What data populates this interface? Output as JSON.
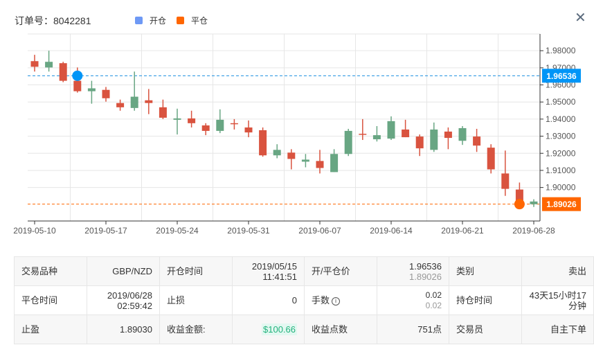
{
  "header": {
    "order_label": "订单号：8042281",
    "close_icon": "close-icon"
  },
  "legend": [
    {
      "label": "开仓",
      "color": "#6e99f5"
    },
    {
      "label": "平仓",
      "color": "#ff6600"
    }
  ],
  "chart_data": {
    "type": "candlestick",
    "x": [
      "2019-05-10",
      "2019-05-13",
      "2019-05-14",
      "2019-05-15",
      "2019-05-16",
      "2019-05-17",
      "2019-05-20",
      "2019-05-21",
      "2019-05-22",
      "2019-05-23",
      "2019-05-24",
      "2019-05-27",
      "2019-05-28",
      "2019-05-29",
      "2019-05-30",
      "2019-05-31",
      "2019-06-03",
      "2019-06-04",
      "2019-06-05",
      "2019-06-06",
      "2019-06-07",
      "2019-06-10",
      "2019-06-11",
      "2019-06-12",
      "2019-06-13",
      "2019-06-14",
      "2019-06-17",
      "2019-06-18",
      "2019-06-19",
      "2019-06-20",
      "2019-06-21",
      "2019-06-24",
      "2019-06-25",
      "2019-06-26",
      "2019-06-27",
      "2019-06-28"
    ],
    "ohlc": [
      [
        1.9739,
        1.9776,
        1.9678,
        1.9706
      ],
      [
        1.9702,
        1.98,
        1.9678,
        1.9735
      ],
      [
        1.9727,
        1.9735,
        1.9616,
        1.9624
      ],
      [
        1.9624,
        1.9702,
        1.9555,
        1.9563
      ],
      [
        1.9563,
        1.9624,
        1.949,
        1.958
      ],
      [
        1.9571,
        1.9588,
        1.9502,
        1.9522
      ],
      [
        1.9494,
        1.9514,
        1.9449,
        1.9469
      ],
      [
        1.9465,
        1.9678,
        1.9449,
        1.9531
      ],
      [
        1.951,
        1.9576,
        1.9429,
        1.9494
      ],
      [
        1.9469,
        1.9514,
        1.94,
        1.9408
      ],
      [
        1.9396,
        1.9461,
        1.931,
        1.9404
      ],
      [
        1.9404,
        1.9449,
        1.9351,
        1.9376
      ],
      [
        1.9363,
        1.9376,
        1.9306,
        1.9331
      ],
      [
        1.9331,
        1.9457,
        1.9318,
        1.9396
      ],
      [
        1.9376,
        1.94,
        1.9339,
        1.9371
      ],
      [
        1.9351,
        1.9392,
        1.9294,
        1.9322
      ],
      [
        1.9335,
        1.9351,
        1.918,
        1.9188
      ],
      [
        1.9188,
        1.9253,
        1.9171,
        1.922
      ],
      [
        1.9204,
        1.9224,
        1.9106,
        1.9167
      ],
      [
        1.9151,
        1.9196,
        1.9118,
        1.9163
      ],
      [
        1.9155,
        1.922,
        1.9082,
        1.9114
      ],
      [
        1.909,
        1.9224,
        1.909,
        1.9196
      ],
      [
        1.9196,
        1.9343,
        1.9184,
        1.9331
      ],
      [
        1.9314,
        1.94,
        1.9278,
        1.931
      ],
      [
        1.9282,
        1.9359,
        1.9269,
        1.9306
      ],
      [
        1.9286,
        1.9416,
        1.9278,
        1.9388
      ],
      [
        1.9339,
        1.9396,
        1.9294,
        1.9294
      ],
      [
        1.9298,
        1.931,
        1.9184,
        1.9229
      ],
      [
        1.922,
        1.938,
        1.9208,
        1.9339
      ],
      [
        1.9327,
        1.9351,
        1.9224,
        1.929
      ],
      [
        1.9273,
        1.9359,
        1.9249,
        1.9347
      ],
      [
        1.9298,
        1.9343,
        1.9208,
        1.9245
      ],
      [
        1.9233,
        1.9253,
        1.9082,
        1.9106
      ],
      [
        1.9082,
        1.9216,
        1.8951,
        1.8992
      ],
      [
        1.8988,
        1.9029,
        1.8906,
        1.891
      ],
      [
        1.8902,
        1.8931,
        1.8886,
        1.8918
      ]
    ],
    "x_tick_labels": [
      "2019-05-10",
      "2019-05-17",
      "2019-05-24",
      "2019-05-31",
      "2019-06-07",
      "2019-06-14",
      "2019-06-21",
      "2019-06-28"
    ],
    "y_tick_labels": [
      "1.98000",
      "1.97000",
      "1.96000",
      "1.95000",
      "1.94000",
      "1.93000",
      "1.92000",
      "1.91000",
      "1.90000"
    ],
    "ylim": [
      1.8804,
      1.9898
    ],
    "up_color": "#68a683",
    "down_color": "#d9533f",
    "markers": [
      {
        "name": "open",
        "date": "2019-05-15",
        "price": 1.96536,
        "label": "1.96536",
        "color": "#0095f7"
      },
      {
        "name": "close",
        "date": "2019-06-27",
        "price": 1.89026,
        "label": "1.89026",
        "color": "#ff6600"
      }
    ]
  },
  "details": {
    "rows": [
      [
        {
          "label": "交易品种",
          "value": "GBP/NZD"
        },
        {
          "label": "开仓时间",
          "value": "2019/05/15",
          "value2": "11:41:51"
        },
        {
          "label": "开/平仓价",
          "value": "1.96536",
          "value2": "1.89026"
        },
        {
          "label": "类别",
          "value": "卖出"
        }
      ],
      [
        {
          "label": "平仓时间",
          "value": "2019/06/28",
          "value2": "02:59:42"
        },
        {
          "label": "止损",
          "value": "0"
        },
        {
          "label": "手数",
          "value": "0.02",
          "value2": "0.02"
        },
        {
          "label": "持仓时间",
          "value": "43天15小时17分钟"
        }
      ],
      [
        {
          "label": "止盈",
          "value": "1.89030"
        },
        {
          "label": "收益金额:",
          "value": "$100.66"
        },
        {
          "label": "收益点数",
          "value": "751点"
        },
        {
          "label": "交易员",
          "value": "自主下单"
        }
      ]
    ],
    "info_icon": "ⓘ"
  }
}
